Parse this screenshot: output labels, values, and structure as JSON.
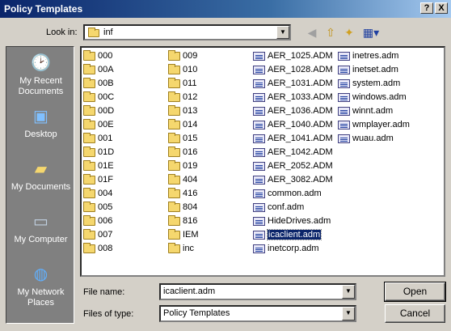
{
  "window": {
    "title": "Policy Templates",
    "help_btn": "?",
    "close_btn": "X"
  },
  "lookin": {
    "label": "Look in:",
    "value": "inf"
  },
  "places": [
    {
      "label": "My Recent Documents",
      "icon": "recent-documents-icon"
    },
    {
      "label": "Desktop",
      "icon": "desktop-icon"
    },
    {
      "label": "My Documents",
      "icon": "my-documents-icon"
    },
    {
      "label": "My Computer",
      "icon": "my-computer-icon"
    },
    {
      "label": "My Network Places",
      "icon": "network-places-icon"
    }
  ],
  "files": [
    [
      "000",
      "00A",
      "00B",
      "00C",
      "00D",
      "00E",
      "001",
      "01D",
      "01E",
      "01F",
      "004",
      "005",
      "006",
      "007",
      "008"
    ],
    [
      "009",
      "010",
      "011",
      "012",
      "013",
      "014",
      "015",
      "016",
      "019",
      "404",
      "416",
      "804",
      "816",
      "IEM",
      "inc"
    ],
    [
      "AER_1025.ADM",
      "AER_1028.ADM",
      "AER_1031.ADM",
      "AER_1033.ADM",
      "AER_1036.ADM",
      "AER_1040.ADM",
      "AER_1041.ADM",
      "AER_1042.ADM",
      "AER_2052.ADM",
      "AER_3082.ADM",
      "common.adm",
      "conf.adm",
      "HideDrives.adm",
      "icaclient.adm",
      "inetcorp.adm"
    ],
    [
      "inetres.adm",
      "inetset.adm",
      "system.adm",
      "windows.adm",
      "winnt.adm",
      "wmplayer.adm",
      "wuau.adm"
    ]
  ],
  "selected_file": "icaclient.adm",
  "filename": {
    "label": "File name:",
    "value": "icaclient.adm"
  },
  "filetype": {
    "label": "Files of type:",
    "value": "Policy Templates"
  },
  "buttons": {
    "open": "Open",
    "cancel": "Cancel"
  }
}
